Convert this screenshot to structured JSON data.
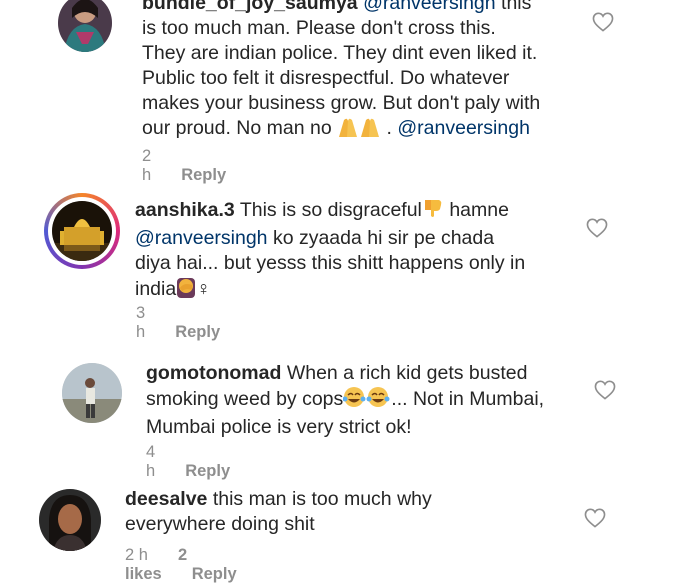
{
  "comments": [
    {
      "username": "bundle_of_joy_saumya",
      "mention_lead": "@ranveersingh",
      "lines": [
        "this",
        "is too much man. Please don't cross this.",
        "They are indian police. They dint even liked it.",
        "Public too felt it disrespectful. Do whatever",
        "makes your business grow. But don't paly with",
        "our proud. No man no"
      ],
      "mention_tail": "@ranveersingh",
      "time": "2 h",
      "reply": "Reply"
    },
    {
      "username": "aanshika.3",
      "line1": "This is so disgraceful",
      "line1_after": "hamne",
      "mention": "@ranveersingh",
      "line2_after": "ko zyaada hi sir pe chada",
      "line3": "diya hai... but yesss this shitt happens only in",
      "line4": "india",
      "line4_after": "♀",
      "time": "3 h",
      "reply": "Reply"
    },
    {
      "username": "gomotonomad",
      "line1": "When a rich kid gets busted",
      "line2_before": "smoking weed by cops",
      "line2_after": "... Not in Mumbai,",
      "line3": "Mumbai police is very strict ok!",
      "time": "4 h",
      "reply": "Reply"
    },
    {
      "username": "deesalve",
      "line1": "this man is too much why",
      "line2": "everywhere doing shit",
      "time": "2 h",
      "likes": "2 likes",
      "reply": "Reply"
    }
  ],
  "colors": {
    "mention": "#003569",
    "meta": "#8e8e8e",
    "text": "#262626"
  },
  "icons": [
    "heart-outline-icon",
    "folded-hands-emoji",
    "thumbs-down-emoji",
    "tears-of-joy-emoji",
    "facepalm-emoji"
  ]
}
